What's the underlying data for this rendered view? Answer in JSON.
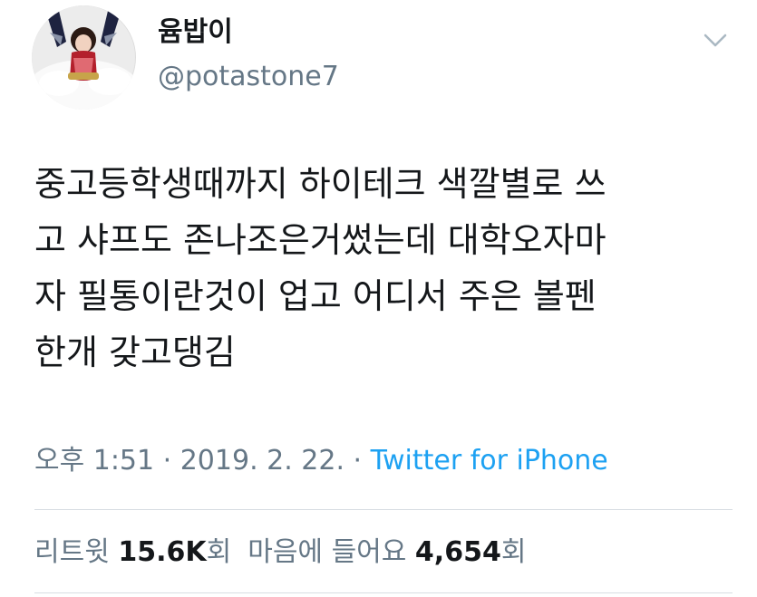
{
  "author": {
    "display_name": "윰밥이",
    "handle": "@potastone7"
  },
  "tweet": {
    "lines": [
      "중고등학생때까지 하이테크 색깔별로 쓰",
      "고 샤프도 존나조은거썼는데 대학오자마",
      "자 필통이란것이 업고 어디서 주은 볼펜",
      "한개 갖고댕김"
    ],
    "time": "오후 1:51",
    "separator1": " · ",
    "date": "2019. 2. 22.",
    "separator2": " · ",
    "source": "Twitter for iPhone"
  },
  "stats": {
    "retweets_label": "리트윗",
    "retweets_count": "15.6K",
    "retweets_unit": "회",
    "likes_label": "마음에 들어요",
    "likes_count": "4,654",
    "likes_unit": "회"
  },
  "icons": {
    "menu": "chevron-down-icon",
    "avatar": "profile-avatar"
  },
  "colors": {
    "text": "#14171a",
    "secondary": "#657786",
    "link": "#1da1f2",
    "divider": "#d8dde2"
  }
}
